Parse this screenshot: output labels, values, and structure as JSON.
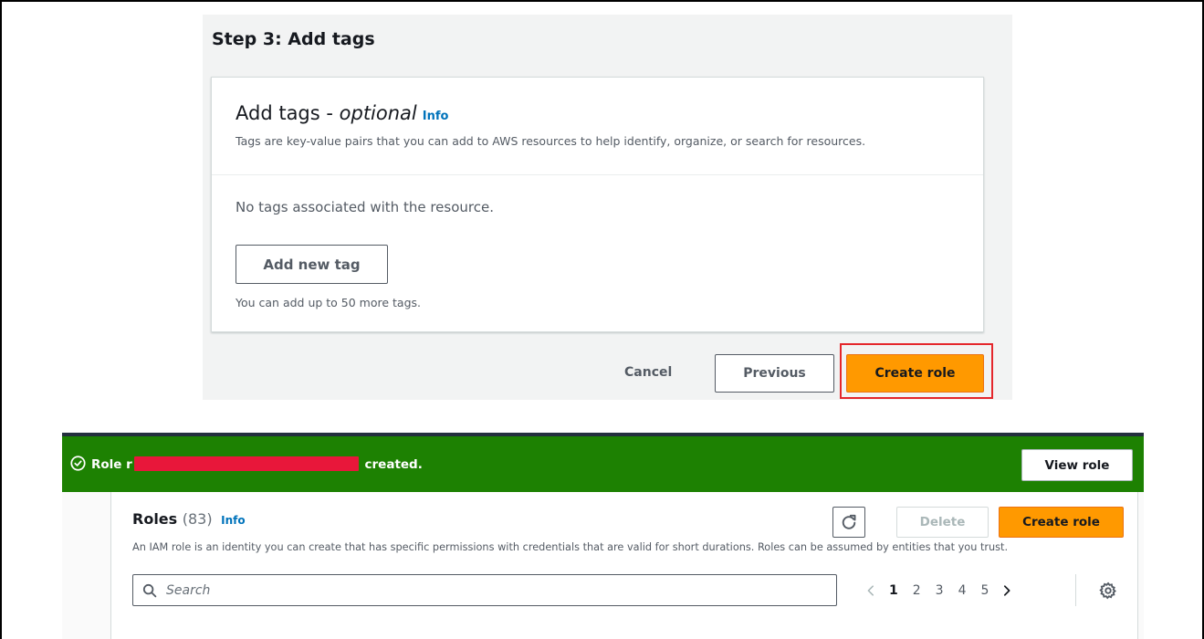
{
  "wizard": {
    "step_title": "Step 3: Add tags",
    "card": {
      "title_main": "Add tags - ",
      "title_optional": "optional",
      "info_link": "Info",
      "description": "Tags are key-value pairs that you can add to AWS resources to help identify, organize, or search for resources.",
      "empty_message": "No tags associated with the resource.",
      "add_tag_label": "Add new tag",
      "limit_hint": "You can add up to 50 more tags."
    },
    "footer": {
      "cancel_label": "Cancel",
      "previous_label": "Previous",
      "create_label": "Create role"
    }
  },
  "flash": {
    "prefix": "Role r",
    "suffix": " created.",
    "view_role_label": "View role"
  },
  "roles": {
    "title": "Roles",
    "count": "(83)",
    "info_link": "Info",
    "description": "An IAM role is an identity you can create that has specific permissions with credentials that are valid for short durations. Roles can be assumed by entities that you trust.",
    "delete_label": "Delete",
    "create_label": "Create role",
    "search_placeholder": "Search",
    "pages": [
      "1",
      "2",
      "3",
      "4",
      "5"
    ],
    "current_page": "1"
  },
  "colors": {
    "primary_button": "#ff9900",
    "success_flash": "#1d8102",
    "link": "#0073bb",
    "highlight": "#e4262b"
  },
  "icons": [
    "check-circle-icon",
    "refresh-icon",
    "search-icon",
    "chevron-left-icon",
    "chevron-right-icon",
    "gear-icon"
  ]
}
